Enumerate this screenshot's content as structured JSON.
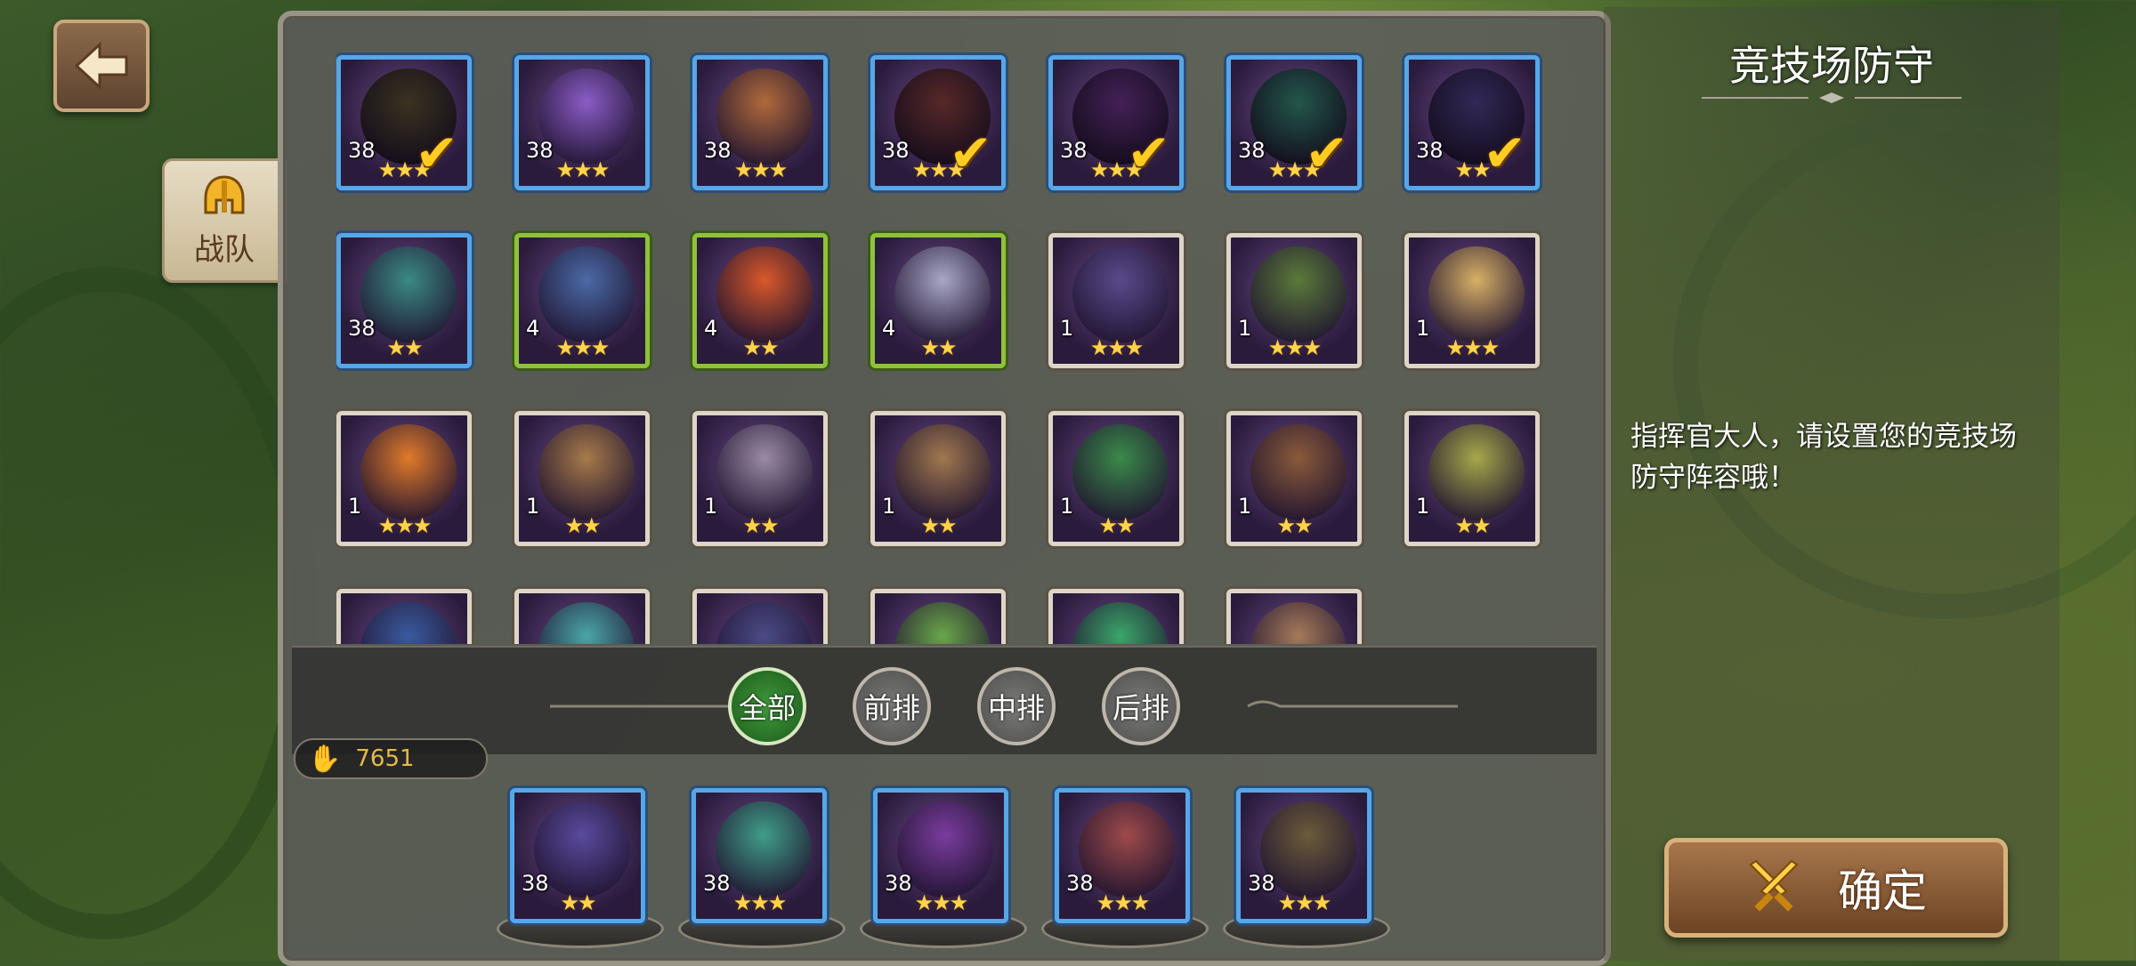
{
  "header": {
    "back_icon": "back-arrow-icon"
  },
  "side_tab": {
    "label": "战队",
    "icon": "helmet-icon"
  },
  "hero_grid": [
    {
      "level": "38",
      "stars": "★★★",
      "frame": "blue",
      "selected": true,
      "color": "#6b5b3a"
    },
    {
      "level": "38",
      "stars": "★★★",
      "frame": "blue",
      "selected": false,
      "color": "#8a5cc6"
    },
    {
      "level": "38",
      "stars": "★★★",
      "frame": "blue",
      "selected": false,
      "color": "#b06a3a"
    },
    {
      "level": "38",
      "stars": "★★★",
      "frame": "blue",
      "selected": true,
      "color": "#9e4a4a"
    },
    {
      "level": "38",
      "stars": "★★★",
      "frame": "blue",
      "selected": true,
      "color": "#7a3c9e"
    },
    {
      "level": "38",
      "stars": "★★★",
      "frame": "blue",
      "selected": true,
      "color": "#3f9e88"
    },
    {
      "level": "38",
      "stars": "★★",
      "frame": "blue",
      "selected": true,
      "color": "#5a4a9e"
    },
    {
      "level": "38",
      "stars": "★★",
      "frame": "blue",
      "selected": false,
      "color": "#3a8a86"
    },
    {
      "level": "4",
      "stars": "★★★",
      "frame": "green",
      "selected": false,
      "color": "#4a6aa6"
    },
    {
      "level": "4",
      "stars": "★★",
      "frame": "green",
      "selected": false,
      "color": "#d9582a"
    },
    {
      "level": "4",
      "stars": "★★",
      "frame": "green",
      "selected": false,
      "color": "#a8a6c6"
    },
    {
      "level": "1",
      "stars": "★★★",
      "frame": "white",
      "selected": false,
      "color": "#5a4a8c"
    },
    {
      "level": "1",
      "stars": "★★★",
      "frame": "white",
      "selected": false,
      "color": "#5a7a3a"
    },
    {
      "level": "1",
      "stars": "★★★",
      "frame": "white",
      "selected": false,
      "color": "#d8b066"
    },
    {
      "level": "1",
      "stars": "★★★",
      "frame": "white",
      "selected": false,
      "color": "#e07a2a"
    },
    {
      "level": "1",
      "stars": "★★",
      "frame": "white",
      "selected": false,
      "color": "#a67a4a"
    },
    {
      "level": "1",
      "stars": "★★",
      "frame": "white",
      "selected": false,
      "color": "#9a8aa6"
    },
    {
      "level": "1",
      "stars": "★★",
      "frame": "white",
      "selected": false,
      "color": "#a0784e"
    },
    {
      "level": "1",
      "stars": "★★",
      "frame": "white",
      "selected": false,
      "color": "#3a8a4a"
    },
    {
      "level": "1",
      "stars": "★★",
      "frame": "white",
      "selected": false,
      "color": "#8a5a3a"
    },
    {
      "level": "1",
      "stars": "★★",
      "frame": "white",
      "selected": false,
      "color": "#a6a84a"
    },
    {
      "level": "",
      "stars": "",
      "frame": "white",
      "selected": false,
      "color": "#3a5a9e"
    },
    {
      "level": "",
      "stars": "",
      "frame": "white",
      "selected": false,
      "color": "#4aa6a8"
    },
    {
      "level": "",
      "stars": "",
      "frame": "white",
      "selected": false,
      "color": "#4a4a86"
    },
    {
      "level": "",
      "stars": "",
      "frame": "white",
      "selected": false,
      "color": "#6aa64a"
    },
    {
      "level": "",
      "stars": "",
      "frame": "white",
      "selected": false,
      "color": "#3aa66a"
    },
    {
      "level": "",
      "stars": "",
      "frame": "white",
      "selected": false,
      "color": "#a67a5a"
    }
  ],
  "filters": [
    {
      "label": "全部",
      "active": true
    },
    {
      "label": "前排",
      "active": false
    },
    {
      "label": "中排",
      "active": false
    },
    {
      "label": "后排",
      "active": false
    }
  ],
  "power": {
    "icon": "paw-icon",
    "value": "7651"
  },
  "lineup": [
    {
      "level": "38",
      "stars": "★★",
      "color": "#5a4a9e"
    },
    {
      "level": "38",
      "stars": "★★★",
      "color": "#3f9e88"
    },
    {
      "level": "38",
      "stars": "★★★",
      "color": "#7a3c9e"
    },
    {
      "level": "38",
      "stars": "★★★",
      "color": "#9e4a4a"
    },
    {
      "level": "38",
      "stars": "★★★",
      "color": "#6b5b3a"
    }
  ],
  "info": {
    "title": "竞技场防守",
    "message": "指挥官大人，请设置您的竞技场防守阵容哦！"
  },
  "confirm": {
    "label": "确定",
    "icon": "crossed-swords-icon"
  }
}
